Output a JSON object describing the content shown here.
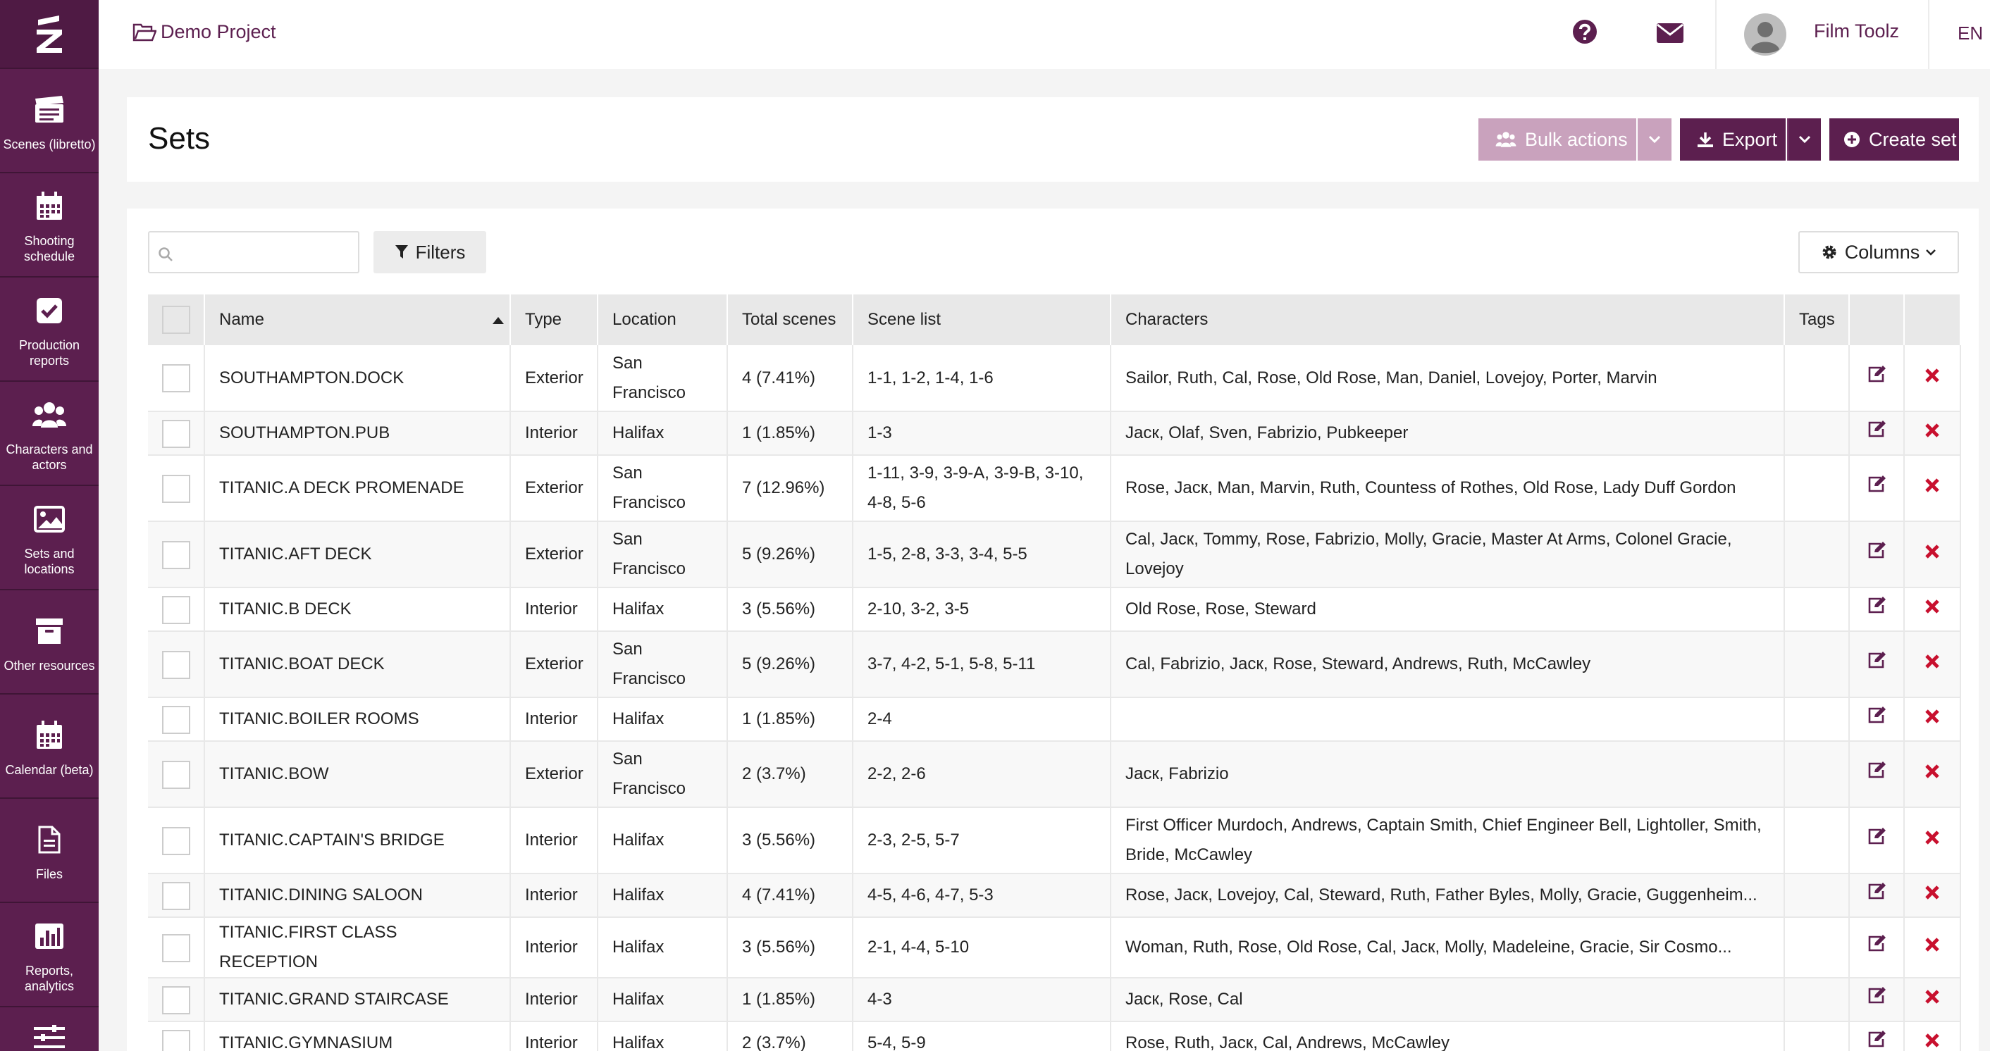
{
  "brand": {
    "accent": "#5c1f4f",
    "sidebar_bg": "#5c1f4f",
    "delete_color": "#c8102e"
  },
  "sidebar": {
    "logo_icon": "filmtoolz-logo-icon",
    "items": [
      {
        "label": "Scenes (libretto)",
        "icon": "clapperboard-icon"
      },
      {
        "label": "Shooting schedule",
        "icon": "calendar-icon"
      },
      {
        "label": "Production reports",
        "icon": "checkbox-icon"
      },
      {
        "label": "Characters and actors",
        "icon": "users-icon"
      },
      {
        "label": "Sets and locations",
        "icon": "image-icon"
      },
      {
        "label": "Other resources",
        "icon": "archive-icon"
      },
      {
        "label": "Calendar (beta)",
        "icon": "calendar-grid-icon"
      },
      {
        "label": "Files",
        "icon": "file-icon"
      },
      {
        "label": "Reports, analytics",
        "icon": "bar-chart-icon"
      },
      {
        "label": "",
        "icon": "sliders-icon"
      }
    ]
  },
  "topbar": {
    "project_name": "Demo Project",
    "user_name": "Film Toolz",
    "language": "EN"
  },
  "page": {
    "title": "Sets"
  },
  "actions": {
    "bulk_label": "Bulk actions",
    "export_label": "Export",
    "create_label": "Create set"
  },
  "toolbar": {
    "search_value": "",
    "search_placeholder": "",
    "filters_label": "Filters",
    "columns_label": "Columns"
  },
  "table": {
    "columns": [
      "Name",
      "Type",
      "Location",
      "Total scenes",
      "Scene list",
      "Characters",
      "Tags"
    ],
    "sort": {
      "column": "Name",
      "direction": "asc"
    },
    "rows": [
      {
        "name": "SOUTHAMPTON.DOCK",
        "type": "Exterior",
        "location": "San Francisco",
        "total": "4 (7.41%)",
        "scenes": "1-1, 1-2, 1-4, 1-6",
        "characters": "Sailor, Ruth, Cal, Rose, Old Rose, Man, Daniel, Lovejoy, Porter, Marvin",
        "tags": ""
      },
      {
        "name": "SOUTHAMPTON.PUB",
        "type": "Interior",
        "location": "Halifax",
        "total": "1 (1.85%)",
        "scenes": "1-3",
        "characters": "Jacк, Olaf, Sven, Fabrizio, Pubkeeper",
        "tags": ""
      },
      {
        "name": "TITANIC.A DECK PROMENADE",
        "type": "Exterior",
        "location": "San Francisco",
        "total": "7 (12.96%)",
        "scenes": "1-11, 3-9, 3-9-A, 3-9-B, 3-10, 4-8, 5-6",
        "characters": "Rose, Jacк, Man, Marvin, Ruth, Countess of Rothes, Old Rose, Lady Duff Gordon",
        "tags": ""
      },
      {
        "name": "TITANIC.AFT DECK",
        "type": "Exterior",
        "location": "San Francisco",
        "total": "5 (9.26%)",
        "scenes": "1-5, 2-8, 3-3, 3-4, 5-5",
        "characters": "Cal, Jacк, Tommy, Rose, Fabrizio, Molly, Gracie, Master At Arms, Colonel Gracie, Lovejoy",
        "tags": ""
      },
      {
        "name": "TITANIC.B DECK",
        "type": "Interior",
        "location": "Halifax",
        "total": "3 (5.56%)",
        "scenes": "2-10, 3-2, 3-5",
        "characters": "Old Rose, Rose, Steward",
        "tags": ""
      },
      {
        "name": "TITANIC.BOAT DECK",
        "type": "Exterior",
        "location": "San Francisco",
        "total": "5 (9.26%)",
        "scenes": "3-7, 4-2, 5-1, 5-8, 5-11",
        "characters": "Cal, Fabrizio, Jacк, Rose, Steward, Andrews, Ruth, McCawley",
        "tags": ""
      },
      {
        "name": "TITANIC.BOILER ROOMS",
        "type": "Interior",
        "location": "Halifax",
        "total": "1 (1.85%)",
        "scenes": "2-4",
        "characters": "",
        "tags": ""
      },
      {
        "name": "TITANIC.BOW",
        "type": "Exterior",
        "location": "San Francisco",
        "total": "2 (3.7%)",
        "scenes": "2-2, 2-6",
        "characters": "Jacк, Fabrizio",
        "tags": ""
      },
      {
        "name": "TITANIC.CAPTAIN'S BRIDGE",
        "type": "Interior",
        "location": "Halifax",
        "total": "3 (5.56%)",
        "scenes": "2-3, 2-5, 5-7",
        "characters": "First Officer Murdoch, Andrews, Captain Smith, Chief Engineer Bell, Lightoller, Smith, Bride, McCawley",
        "tags": ""
      },
      {
        "name": "TITANIC.DINING SALOON",
        "type": "Interior",
        "location": "Halifax",
        "total": "4 (7.41%)",
        "scenes": "4-5, 4-6, 4-7, 5-3",
        "characters": "Rose, Jacк, Lovejoy, Cal, Steward, Ruth, Father Byles, Molly, Gracie, Guggenheim...",
        "tags": ""
      },
      {
        "name": "TITANIC.FIRST CLASS RECEPTION",
        "type": "Interior",
        "location": "Halifax",
        "total": "3 (5.56%)",
        "scenes": "2-1, 4-4, 5-10",
        "characters": "Woman, Ruth, Rose, Old Rose, Cal, Jacк, Molly, Madeleine, Gracie, Sir Cosmo...",
        "tags": ""
      },
      {
        "name": "TITANIC.GRAND STAIRCASE",
        "type": "Interior",
        "location": "Halifax",
        "total": "1 (1.85%)",
        "scenes": "4-3",
        "characters": "Jacк, Rose, Cal",
        "tags": ""
      },
      {
        "name": "TITANIC.GYMNASIUM",
        "type": "Interior",
        "location": "Halifax",
        "total": "2 (3.7%)",
        "scenes": "5-4, 5-9",
        "characters": "Rose, Ruth, Jacк, Cal, Andrews, McCawley",
        "tags": ""
      }
    ]
  }
}
